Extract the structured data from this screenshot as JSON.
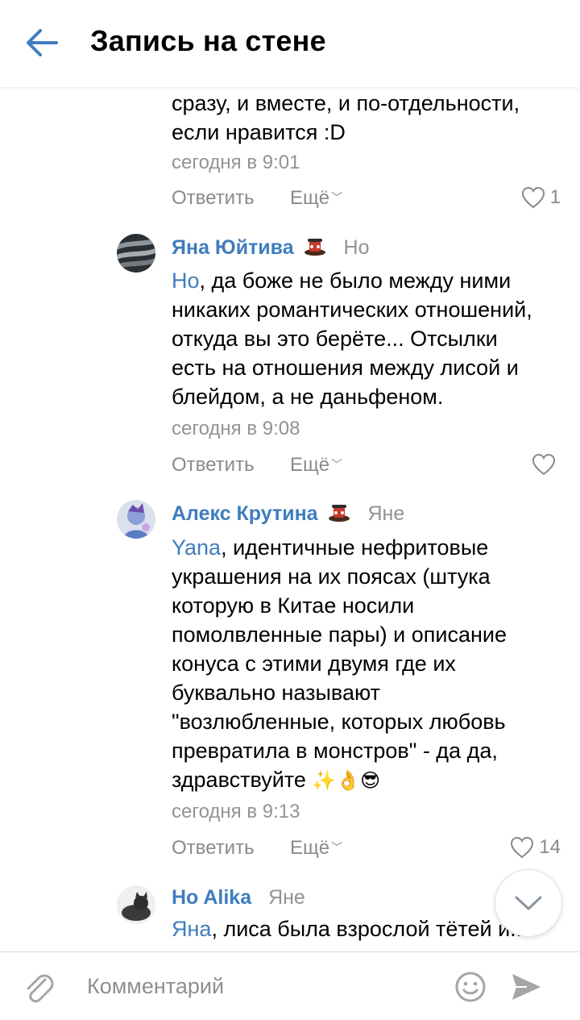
{
  "header": {
    "title": "Запись на стене"
  },
  "comments": [
    {
      "text_lines": [
        "сразу, и вместе, и по-отдельности,",
        "если нравится :D"
      ],
      "time": "сегодня в 9:01",
      "reply_label": "Ответить",
      "more_label": "Ещё",
      "likes": "1"
    },
    {
      "author": "Яна Юйтива",
      "reply_to": "Но",
      "mention": "Но",
      "text_first": ", да боже не было между ними",
      "text_lines": [
        "никаких романтических отношений,",
        "откуда вы это берёте... Отсылки",
        "есть на отношения между лисой и",
        "блейдом, а не даньфеном."
      ],
      "time": "сегодня в 9:08",
      "reply_label": "Ответить",
      "more_label": "Ещё",
      "likes": ""
    },
    {
      "author": "Алекс Крутина",
      "reply_to": "Яне",
      "mention": "Yana",
      "text_first": ", идентичные нефритовые",
      "text_lines": [
        "украшения на их поясах (штука",
        "которую в Китае носили",
        "помолвленные пары) и описание",
        "конуса с этими двумя где их",
        "буквально называют",
        "\"возлюбленные, которых любовь",
        "превратила в монстров\" - да да,"
      ],
      "text_last": "здравствуйте ",
      "emojis": "✨👌😎",
      "time": "сегодня в 9:13",
      "reply_label": "Ответить",
      "more_label": "Ещё",
      "likes": "14"
    },
    {
      "author": "Ho Alika",
      "reply_to": "Яне",
      "mention": "Яна",
      "text_first": ", лиса была взрослой тётей и..."
    }
  ],
  "composer": {
    "placeholder": "Комментарий"
  },
  "colors": {
    "link": "#3f7dbd",
    "accent": "#4a76a8",
    "muted": "#939393"
  }
}
